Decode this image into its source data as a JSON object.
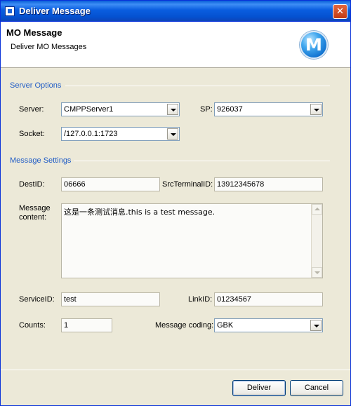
{
  "window": {
    "title": "Deliver Message"
  },
  "header": {
    "title": "MO Message",
    "subtitle": "Deliver MO Messages",
    "logo_letter": "M"
  },
  "server_options": {
    "section_label": "Server Options",
    "server_label": "Server:",
    "server_value": "CMPPServer1",
    "sp_label": "SP:",
    "sp_value": "926037",
    "socket_label": "Socket:",
    "socket_value": "/127.0.0.1:1723"
  },
  "message_settings": {
    "section_label": "Message Settings",
    "dest_id_label": "DestID:",
    "dest_id_value": "06666",
    "src_terminal_label": "SrcTerminalID:",
    "src_terminal_value": "13912345678",
    "content_label_1": "Message",
    "content_label_2": "content:",
    "content_value": "这是一条测试消息.this is a test message.",
    "service_id_label": "ServiceID:",
    "service_id_value": "test",
    "link_id_label": "LinkID:",
    "link_id_value": "01234567",
    "counts_label": "Counts:",
    "counts_value": "1",
    "coding_label": "Message coding:",
    "coding_value": "GBK"
  },
  "buttons": {
    "deliver": "Deliver",
    "cancel": "Cancel"
  },
  "icons": {
    "close": "close-icon",
    "app": "app-icon",
    "logo": "logo-icon",
    "dropdown": "chevron-down-icon"
  }
}
